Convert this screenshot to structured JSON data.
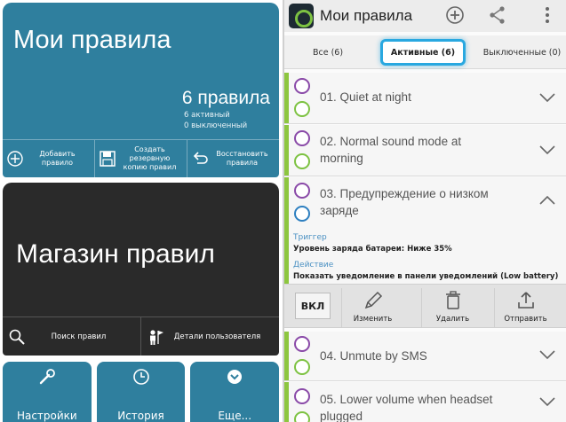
{
  "left": {
    "my_rules": {
      "title": "Мои правила",
      "count": "6 правила",
      "active": "6 активный",
      "disabled": "0 выключенный",
      "actions": [
        {
          "label": "Добавить\nправило",
          "icon": "plus-circle-icon"
        },
        {
          "label": "Создать\nрезервную\nкопию правил",
          "icon": "save-icon"
        },
        {
          "label": "Восстановить\nправила",
          "icon": "undo-icon"
        }
      ]
    },
    "store": {
      "title": "Магазин правил",
      "actions": [
        {
          "label": "Поиск правил",
          "icon": "search-icon"
        },
        {
          "label": "Детали пользователя",
          "icon": "user-flag-icon"
        }
      ]
    },
    "bottom_tiles": [
      {
        "label": "Настройки",
        "icon": "wrench-icon"
      },
      {
        "label": "История",
        "icon": "clock-icon"
      },
      {
        "label": "Еще...",
        "icon": "chevron-circle-icon"
      }
    ]
  },
  "right": {
    "appbar": {
      "title": "Мои правила",
      "icons": [
        "add-circle-icon",
        "share-icon",
        "overflow-menu-icon"
      ]
    },
    "tabs": [
      {
        "label": "Все (6)",
        "active": false
      },
      {
        "label": "Активные (6)",
        "active": true
      },
      {
        "label": "Выключенные (0)",
        "active": false
      }
    ],
    "rules": [
      {
        "name": "01. Quiet at night",
        "icon": "alarm-clock-icon",
        "expanded": false
      },
      {
        "name": "02. Normal sound mode at\nmorning",
        "icon": "alarm-clock-icon",
        "expanded": false
      },
      {
        "name": "03. Предупреждение о низком\nзаряде",
        "icon": "battery-icon",
        "expanded": true
      },
      {
        "name": "04. Unmute by SMS",
        "icon": "sms-icon",
        "expanded": false
      },
      {
        "name": "05. Lower volume when headset\nplugged",
        "icon": "headset-icon",
        "expanded": false
      }
    ],
    "detail": {
      "trigger_heading": "Триггер",
      "trigger_text": "Уровень заряда батареи: Ниже 35%",
      "action_heading": "Действие",
      "action_text": "Показать уведомление в панели уведомлений (Low battery)"
    },
    "toolbar": {
      "toggle_label": "ВКЛ",
      "buttons": [
        {
          "label": "Изменить",
          "icon": "pencil-icon"
        },
        {
          "label": "Удалить",
          "icon": "trash-icon"
        },
        {
          "label": "Отправить",
          "icon": "upload-icon"
        }
      ]
    },
    "colors": {
      "accent": "#8dc63f",
      "tab_highlight": "#29a8e0",
      "tile_blue": "#2f7f9e"
    }
  }
}
